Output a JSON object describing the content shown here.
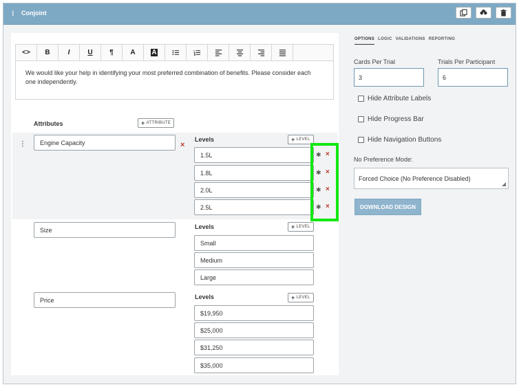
{
  "window": {
    "title": "Conjoint",
    "buttons": [
      "copy-icon",
      "cloud-download-icon",
      "trash-icon"
    ]
  },
  "editor": {
    "toolbar": [
      "<>",
      "B",
      "I",
      "U",
      "¶",
      "A",
      "A",
      "bulleted-list-icon",
      "numbered-list-icon",
      "align-left-icon",
      "align-center-icon",
      "align-right-icon",
      "align-justify-icon"
    ],
    "text": "We would like your help in identifying your most preferred combination of benefits. Please consider each one independently."
  },
  "attributes": {
    "heading": "Attributes",
    "add_label": "ATTRIBUTE",
    "levels_heading": "Levels",
    "add_level_label": "LEVEL",
    "items": [
      {
        "name": "Engine Capacity",
        "levels": [
          "1.5L",
          "1.8L",
          "2.0L",
          "2.5L"
        ]
      },
      {
        "name": "Size",
        "levels": [
          "Small",
          "Medium",
          "Large"
        ]
      },
      {
        "name": "Price",
        "levels": [
          "$19,950",
          "$25,000",
          "$31,250",
          "$35,000"
        ]
      }
    ]
  },
  "sidebar": {
    "tabs": [
      "OPTIONS",
      "LOGIC",
      "VALIDATIONS",
      "REPORTING"
    ],
    "active_tab": "OPTIONS",
    "cards_per_trial_label": "Cards Per Trial",
    "cards_per_trial": "3",
    "trials_per_participant_label": "Trials Per Participant",
    "trials_per_participant": "6",
    "checkboxes": [
      "Hide Attribute Labels",
      "Hide Progress Bar",
      "Hide Navigation Buttons"
    ],
    "no_pref_label": "No Preference Mode:",
    "no_pref_value": "Forced Choice (No Preference Disabled)",
    "download_label": "DOWNLOAD DESIGN"
  },
  "colors": {
    "titlebar": "#7ea9c5",
    "highlight": "#11e810",
    "delete": "#c0392b",
    "download_button": "#8fb4cd"
  }
}
